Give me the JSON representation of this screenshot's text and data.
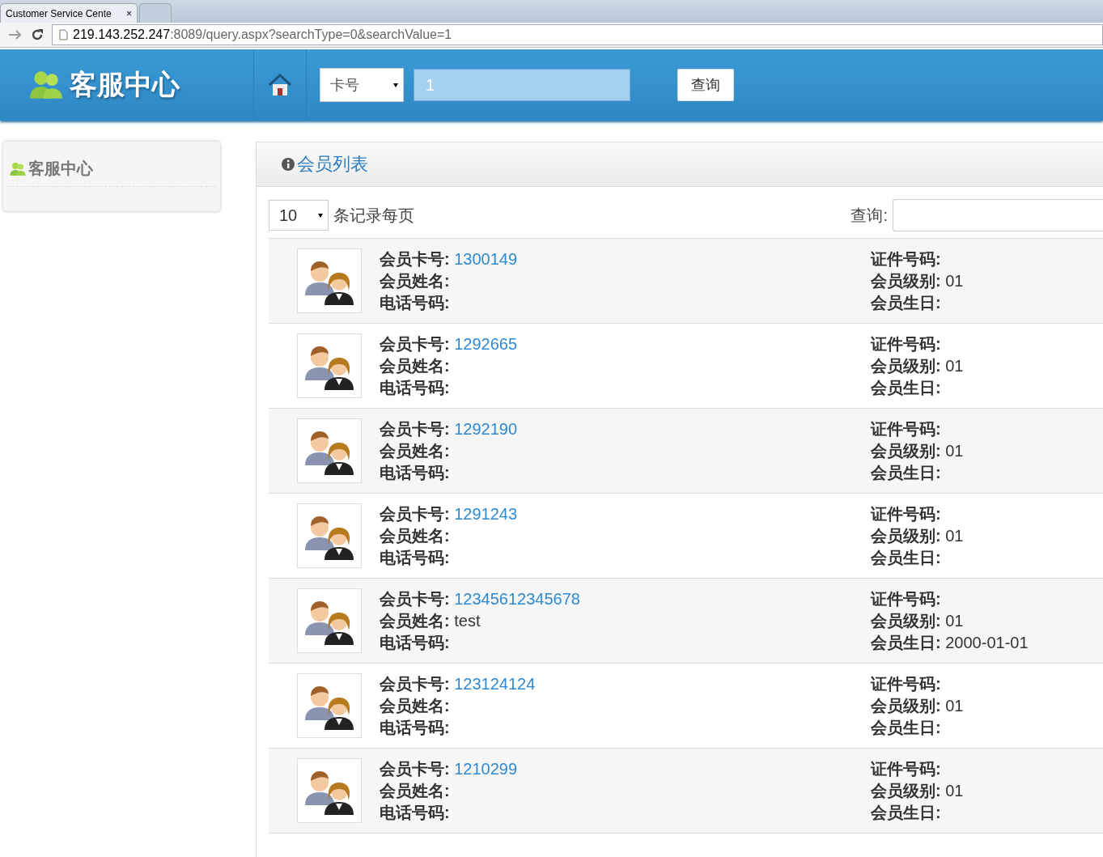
{
  "browser": {
    "tabs": [
      {
        "title": "Customer Service Cente",
        "close": "×",
        "selected": true
      },
      {
        "selected": false
      }
    ],
    "url_host": "219.143.252.247",
    "url_rest": ":8089/query.aspx?searchType=0&searchValue=1"
  },
  "header": {
    "logo": "客服中心",
    "search_type": "卡号",
    "search_value": "1",
    "search_button": "查询"
  },
  "sidebar": {
    "items": [
      {
        "label": "客服中心"
      }
    ]
  },
  "panel": {
    "title": "会员列表",
    "page_size": "10",
    "page_size_label": "条记录每页",
    "search_label": "查询:",
    "rows": [
      {
        "left": [
          {
            "label": "会员卡号:",
            "value": "1300149",
            "kind": "link"
          },
          {
            "label": "会员姓名:"
          },
          {
            "label": "电话号码:"
          }
        ],
        "right": [
          {
            "label": "证件号码:"
          },
          {
            "label": "会员级别:",
            "value": "01"
          },
          {
            "label": "会员生日:"
          }
        ]
      },
      {
        "left": [
          {
            "label": "会员卡号:",
            "value": "1292665",
            "kind": "link"
          },
          {
            "label": "会员姓名:"
          },
          {
            "label": "电话号码:"
          }
        ],
        "right": [
          {
            "label": "证件号码:"
          },
          {
            "label": "会员级别:",
            "value": "01"
          },
          {
            "label": "会员生日:"
          }
        ]
      },
      {
        "left": [
          {
            "label": "会员卡号:",
            "value": "1292190",
            "kind": "link"
          },
          {
            "label": "会员姓名:"
          },
          {
            "label": "电话号码:"
          }
        ],
        "right": [
          {
            "label": "证件号码:"
          },
          {
            "label": "会员级别:",
            "value": "01"
          },
          {
            "label": "会员生日:"
          }
        ]
      },
      {
        "left": [
          {
            "label": "会员卡号:",
            "value": "1291243",
            "kind": "link"
          },
          {
            "label": "会员姓名:"
          },
          {
            "label": "电话号码:"
          }
        ],
        "right": [
          {
            "label": "证件号码:"
          },
          {
            "label": "会员级别:",
            "value": "01"
          },
          {
            "label": "会员生日:"
          }
        ]
      },
      {
        "left": [
          {
            "label": "会员卡号:",
            "value": "12345612345678",
            "kind": "link"
          },
          {
            "label": "会员姓名:",
            "value": "test"
          },
          {
            "label": "电话号码:"
          }
        ],
        "right": [
          {
            "label": "证件号码:"
          },
          {
            "label": "会员级别:",
            "value": "01"
          },
          {
            "label": "会员生日:",
            "value": "2000-01-01"
          }
        ]
      },
      {
        "left": [
          {
            "label": "会员卡号:",
            "value": "123124124",
            "kind": "link"
          },
          {
            "label": "会员姓名:"
          },
          {
            "label": "电话号码:"
          }
        ],
        "right": [
          {
            "label": "证件号码:"
          },
          {
            "label": "会员级别:",
            "value": "01"
          },
          {
            "label": "会员生日:"
          }
        ]
      },
      {
        "left": [
          {
            "label": "会员卡号:",
            "value": "1210299",
            "kind": "link"
          },
          {
            "label": "会员姓名:"
          },
          {
            "label": "电话号码:"
          }
        ],
        "right": [
          {
            "label": "证件号码:"
          },
          {
            "label": "会员级别:",
            "value": "01"
          },
          {
            "label": "会员生日:"
          }
        ]
      }
    ]
  }
}
